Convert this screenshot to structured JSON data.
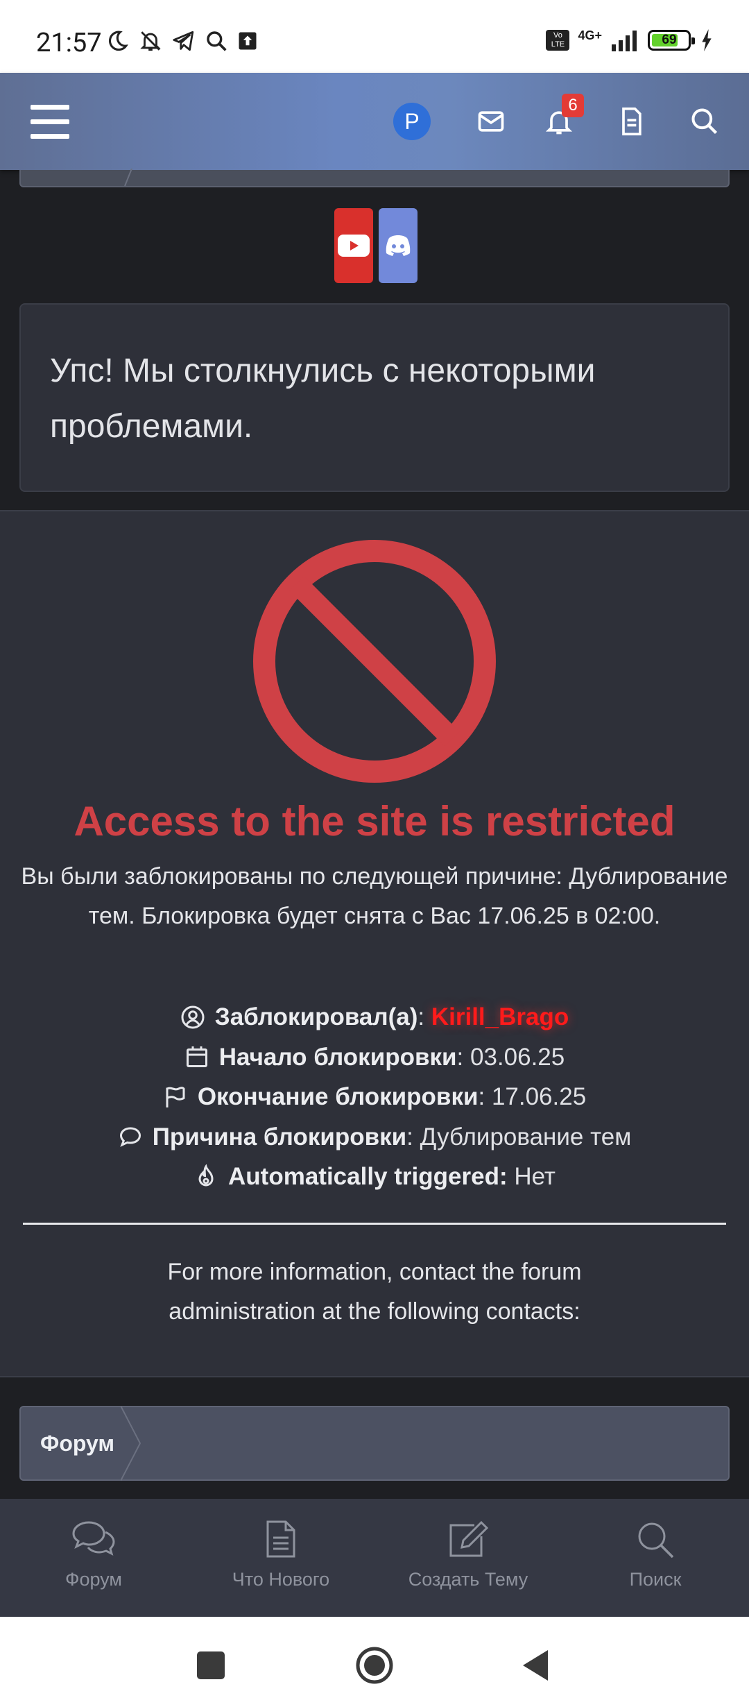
{
  "status_bar": {
    "time": "21:57",
    "network": "4G+",
    "volte": "Vo LTE",
    "battery": "69"
  },
  "header": {
    "avatar_letter": "P",
    "notification_count": "6"
  },
  "notice": {
    "text": "Упс! Мы столкнулись с некоторыми проблемами."
  },
  "ban": {
    "title": "Access to the site is restricted",
    "reason_text": "Вы были заблокированы по следующей причине: Дублирование тем. Блокировка будет снята с Вас 17.06.25 в 02:00.",
    "banned_by_label": "Заблокировал(а)",
    "banned_by_value": "Kirill_Brago",
    "start_label": "Начало блокировки",
    "start_value": "03.06.25",
    "end_label": "Окончание блокировки",
    "end_value": "17.06.25",
    "cause_label": "Причина блокировки",
    "cause_value": "Дублирование тем",
    "auto_label": "Automatically triggered:",
    "auto_value": "Нет",
    "more_info": "For more information, contact the forum administration at the following contacts:",
    "colors": {
      "title": "#cf4146",
      "banner_name": "#ff1b1b"
    }
  },
  "breadcrumb": {
    "label": "Форум"
  },
  "bottom_nav": [
    {
      "label": "Форум",
      "icon": "forum-icon"
    },
    {
      "label": "Что Нового",
      "icon": "whats-new-icon"
    },
    {
      "label": "Создать Тему",
      "icon": "create-thread-icon"
    },
    {
      "label": "Поиск",
      "icon": "search-icon"
    }
  ]
}
